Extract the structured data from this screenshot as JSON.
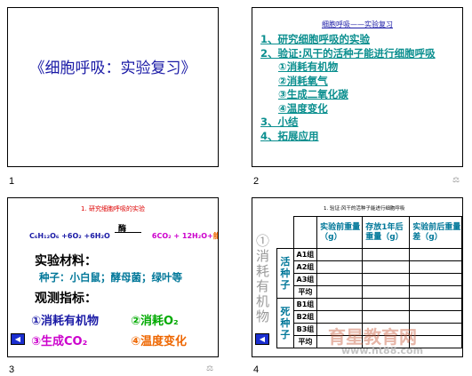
{
  "slides": [
    {
      "number": "1",
      "title": "《细胞呼吸：实验复习》"
    },
    {
      "number": "2",
      "header": "细胞呼吸——实验复习",
      "items": [
        "1、研究细胞呼吸的实验",
        "2、验证:风干的活种子能进行细胞呼吸",
        "①消耗有机物",
        "②消耗氧气",
        "③生成二氧化碳",
        "④温度变化",
        "3、小结",
        "4、拓展应用"
      ]
    },
    {
      "number": "3",
      "header": "1. 研究细胞呼吸的实验",
      "equation_left": "C₆H₁₂O₆ +6O₂ +6H₂O",
      "enzyme": "酶",
      "equation_right": "6CO₂ + 12H₂O+",
      "energy": "能量",
      "materials_title": "实验材料：",
      "materials": "种子：小白鼠；酵母菌；绿叶等",
      "indicators_title": "观测指标：",
      "indicators": [
        "①消耗有机物",
        "②消耗O₂",
        "③生成CO₂",
        "④温度变化"
      ]
    },
    {
      "number": "4",
      "header": "1. 验证:风干的活种子能进行细胞呼吸",
      "side_label": "①消耗有机物",
      "columns": [
        "实验前重量（g）",
        "存放1年后重量（g）",
        "实验前后重量差（g）"
      ],
      "live_label": "活种子",
      "dead_label": "死种子",
      "live_rows": [
        "A1组",
        "A2组",
        "A3组",
        "平均"
      ],
      "dead_rows": [
        "B1组",
        "B2组",
        "B3组",
        "平均"
      ],
      "watermark": "育星教育网",
      "watermark_url": "www.ht88.com"
    }
  ],
  "colors": {
    "title": "#1a1aa6",
    "teal": "#0b8f8f",
    "red": "#dd0000",
    "nav": "#1b2fd0"
  }
}
